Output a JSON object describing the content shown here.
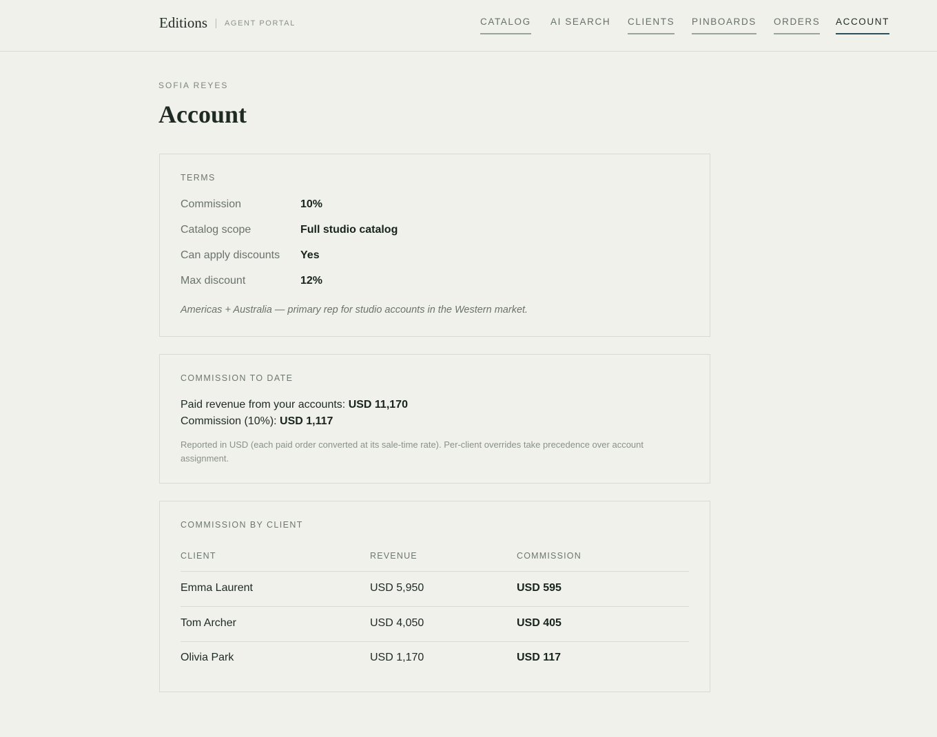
{
  "header": {
    "brand": "Editions",
    "portal": "AGENT PORTAL",
    "nav": [
      {
        "label": "CATALOG"
      },
      {
        "label": "AI SEARCH"
      },
      {
        "label": "CLIENTS"
      },
      {
        "label": "PINBOARDS"
      },
      {
        "label": "ORDERS"
      },
      {
        "label": "ACCOUNT"
      }
    ]
  },
  "page": {
    "eyebrow": "SOFIA REYES",
    "title": "Account"
  },
  "terms": {
    "title": "TERMS",
    "rows": [
      {
        "label": "Commission",
        "value": "10%"
      },
      {
        "label": "Catalog scope",
        "value": "Full studio catalog"
      },
      {
        "label": "Can apply discounts",
        "value": "Yes"
      },
      {
        "label": "Max discount",
        "value": "12%"
      }
    ],
    "note": "Americas + Australia — primary rep for studio accounts in the Western market."
  },
  "commission_to_date": {
    "title": "COMMISSION TO DATE",
    "revenue_label": "Paid revenue from your accounts: ",
    "revenue_value": "USD 11,170",
    "commission_label": "Commission (10%): ",
    "commission_value": "USD 1,117",
    "note": "Reported in USD (each paid order converted at its sale-time rate). Per-client overrides take precedence over account assignment."
  },
  "commission_by_client": {
    "title": "COMMISSION BY CLIENT",
    "columns": [
      "CLIENT",
      "REVENUE",
      "COMMISSION"
    ],
    "rows": [
      {
        "client": "Emma Laurent",
        "revenue": "USD 5,950",
        "commission": "USD 595"
      },
      {
        "client": "Tom Archer",
        "revenue": "USD 4,050",
        "commission": "USD 405"
      },
      {
        "client": "Olivia Park",
        "revenue": "USD 1,170",
        "commission": "USD 117"
      }
    ]
  }
}
